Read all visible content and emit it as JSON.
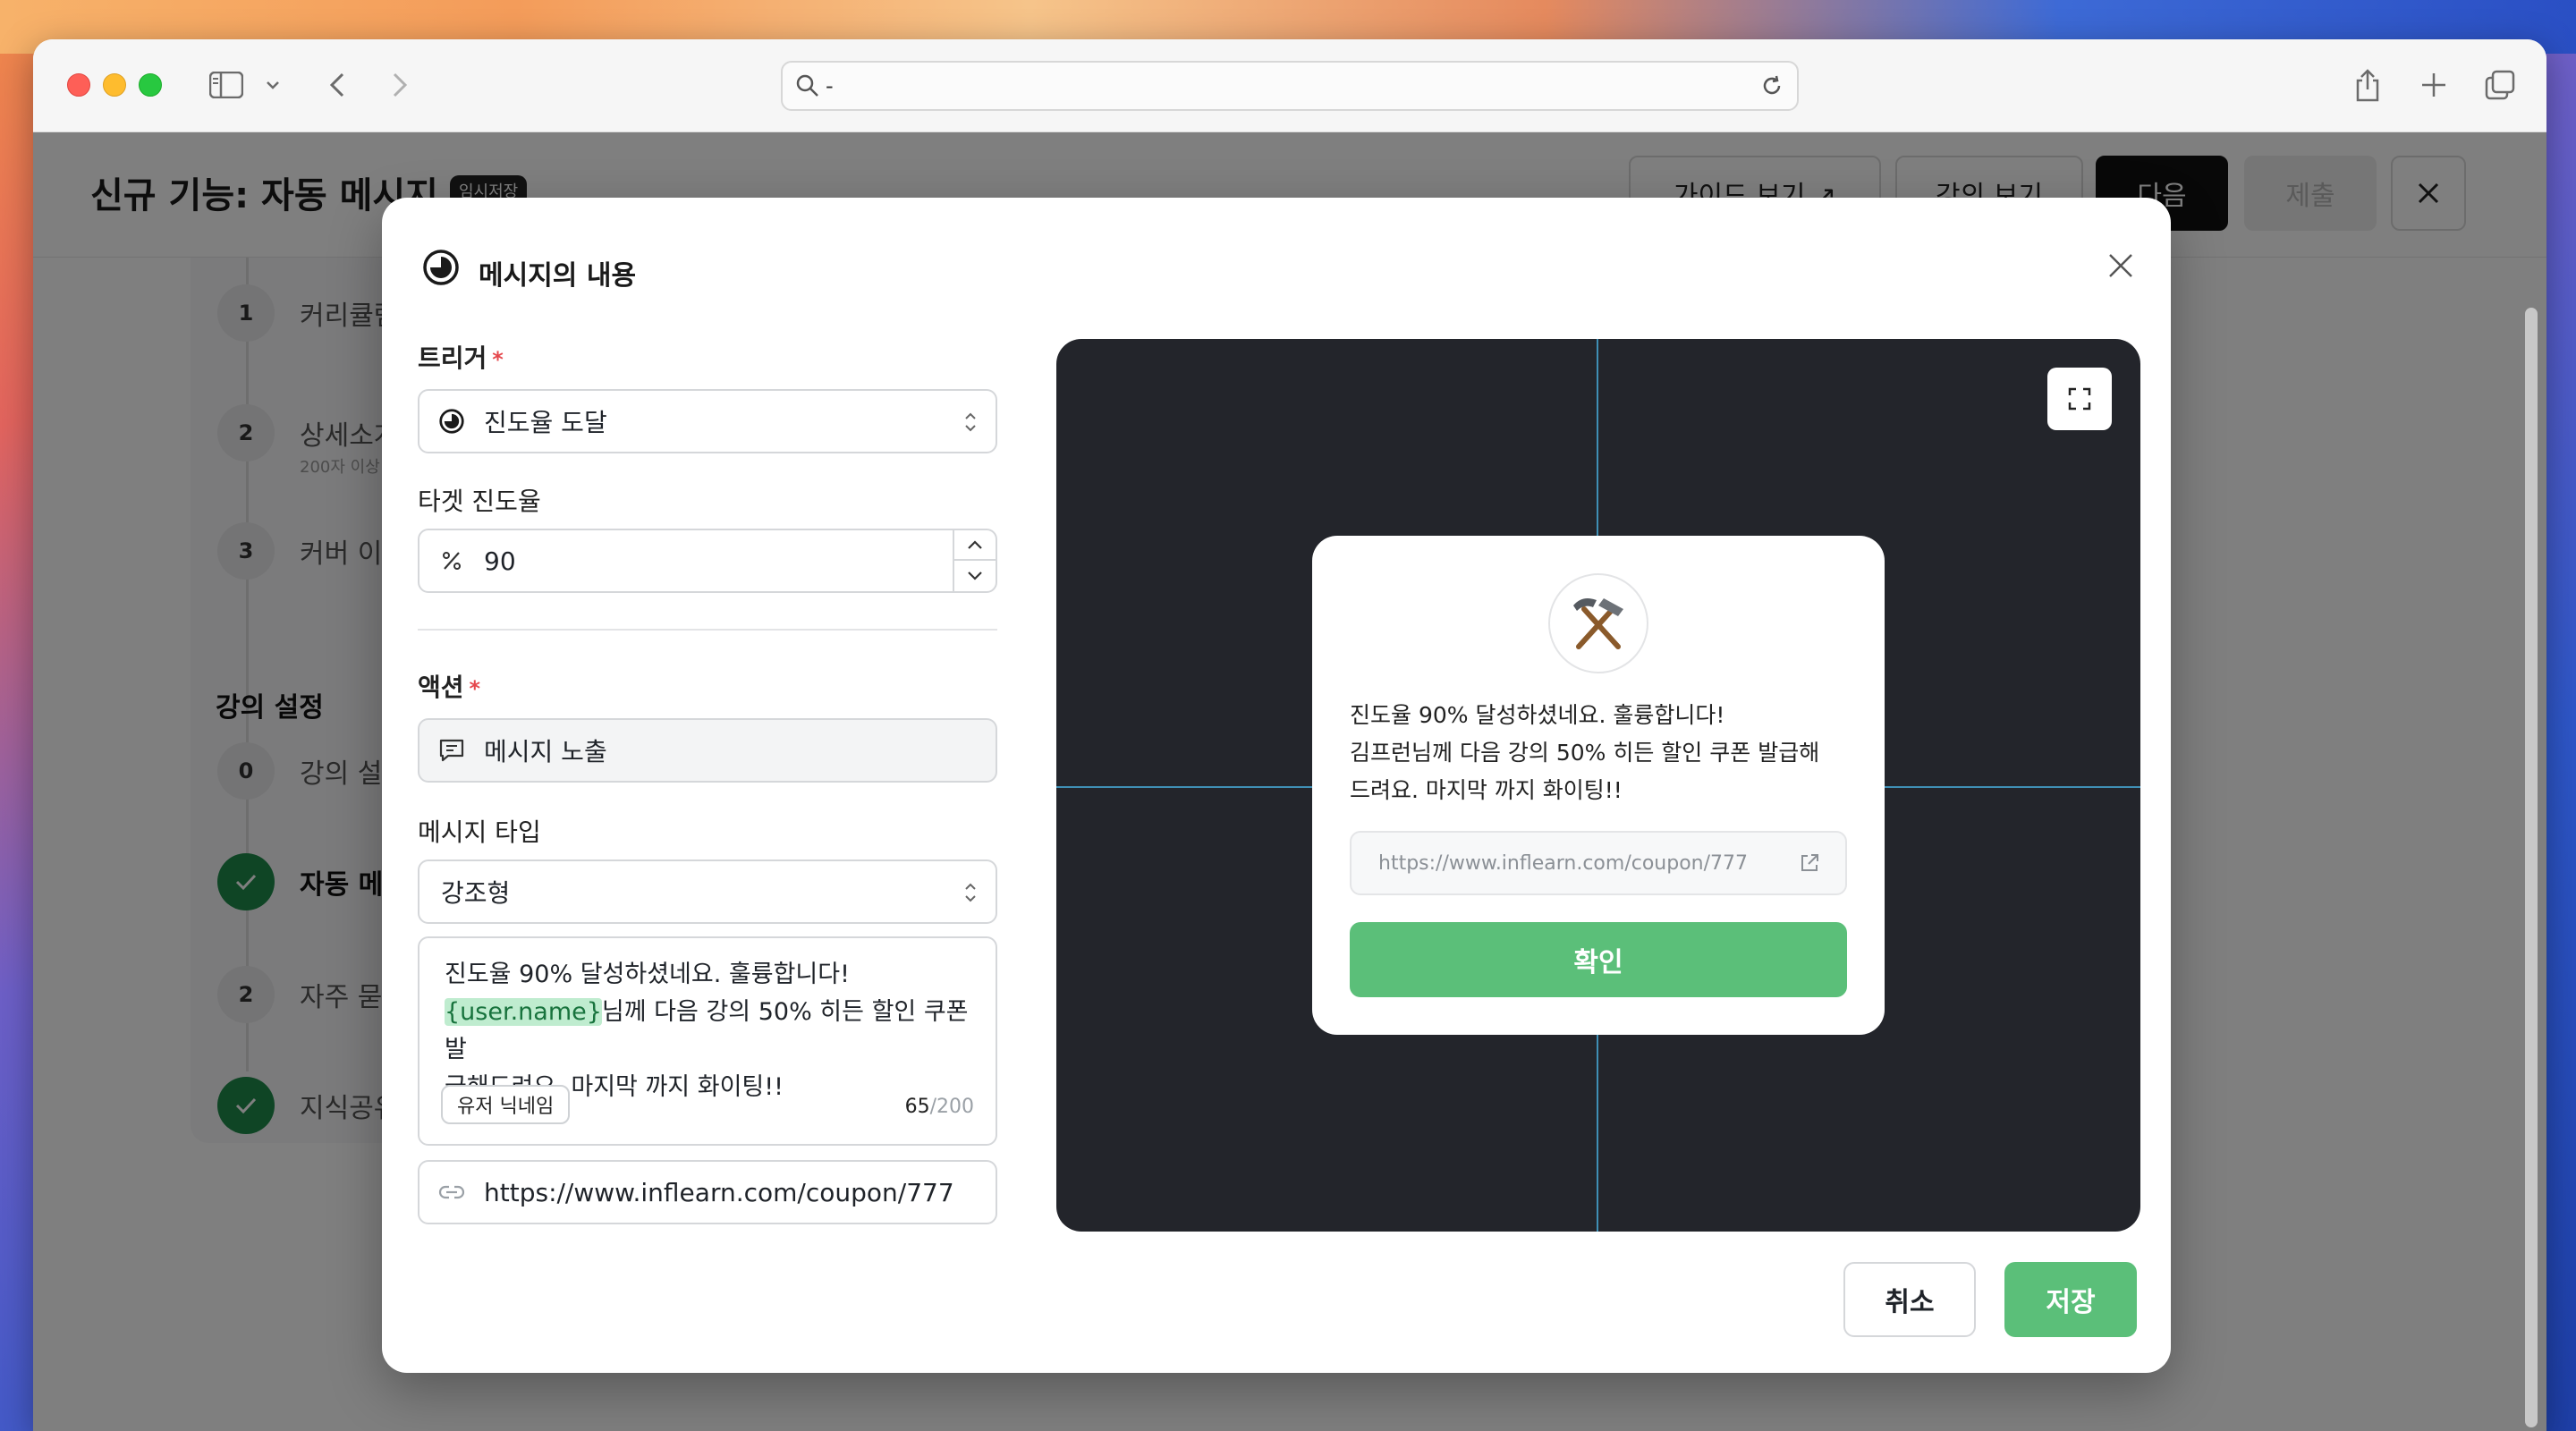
{
  "browser": {
    "url_text": "-"
  },
  "page": {
    "title": "신규 기능: 자동 메시지",
    "draft_badge": "임시저장",
    "header_buttons": {
      "guide": "가이드 보기 ↗",
      "preview_course": "강의 보기",
      "next": "다음",
      "submit": "제출"
    },
    "steps_top": [
      {
        "num": "1",
        "label": "커리큘럼"
      },
      {
        "num": "2",
        "label": "상세소개",
        "sub": "200자 이상"
      },
      {
        "num": "3",
        "label": "커버 이미지"
      }
    ],
    "section_course_settings": "강의 설정",
    "steps_bottom": [
      {
        "num": "0",
        "label": "강의 설정"
      },
      {
        "label": "자동 메시지"
      },
      {
        "num": "2",
        "label": "자주 묻는 질문"
      },
      {
        "label": "지식공유자"
      }
    ]
  },
  "modal": {
    "title": "메시지의 내용",
    "trigger": {
      "label": "트리거",
      "required_mark": "*",
      "value": "진도율 도달"
    },
    "target_progress": {
      "label": "타겟 진도율",
      "value": "90"
    },
    "action": {
      "label": "액션",
      "required_mark": "*",
      "value": "메시지 노출"
    },
    "message_type": {
      "label": "메시지 타입",
      "value": "강조형"
    },
    "message_body": {
      "line1": "진도율 90% 달성하셨네요. 훌륭합니다!",
      "variable": "{user.name}",
      "line2_rest": "님께 다음 강의 50% 히든 할인 쿠폰 발",
      "line3": "급해드려요. 마지막 까지 화이팅!!",
      "chip": "유저 닉네임",
      "count": "65",
      "max": "/200"
    },
    "link": {
      "value": "https://www.inflearn.com/coupon/777"
    },
    "preview": {
      "message_lines": [
        "진도율 90% 달성하셨네요. 훌륭합니다!",
        "김프런님께 다음 강의 50% 히든 할인 쿠폰 발급해",
        "드려요. 마지막 까지 화이팅!!"
      ],
      "link": "https://www.inflearn.com/coupon/777",
      "confirm": "확인",
      "icon": "hammer-pick-icon"
    },
    "footer": {
      "cancel": "취소",
      "save": "저장"
    }
  },
  "colors": {
    "accent_green": "#5bbf79",
    "preview_bg": "#23252b",
    "required_red": "#e5484d",
    "guide_line": "#3f8fb5"
  }
}
